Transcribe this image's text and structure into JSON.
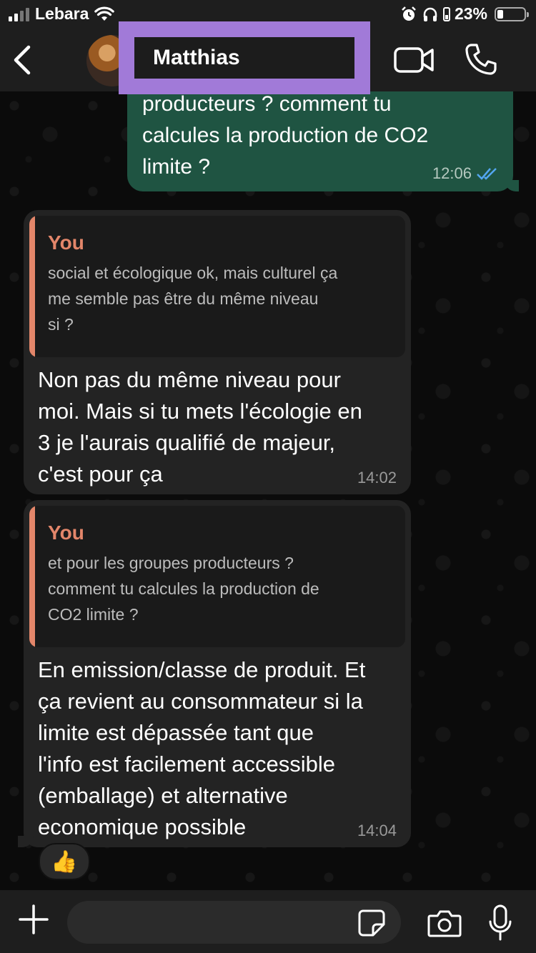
{
  "status_bar": {
    "carrier": "Lebara",
    "battery": "23%",
    "battery_level": 0.23
  },
  "header": {
    "contact_name": "Matthias"
  },
  "messages": {
    "outgoing": {
      "text": "producteurs ? comment tu\ncalcules la production de CO2\nlimite ?",
      "time": "12:06"
    },
    "incoming_1": {
      "quote_author": "You",
      "quote_text": "social et écologique ok, mais culturel ça\nme semble pas être du même niveau\nsi ?",
      "text": "Non pas du même niveau pour\nmoi. Mais si tu mets l'écologie en\n3 je l'aurais qualifié de majeur,\nc'est pour ça",
      "time": "14:02"
    },
    "incoming_2": {
      "quote_author": "You",
      "quote_text": "et pour les groupes producteurs ?\ncomment tu calcules la production de\nCO2 limite ?",
      "text": "En emission/classe de produit. Et\nça revient au consommateur si la\nlimite est dépassée tant que\nl'info est facilement accessible\n(emballage) et alternative\neconomique possible",
      "time": "14:04",
      "reaction": "👍"
    }
  },
  "input_bar": {
    "placeholder": ""
  },
  "colors": {
    "outgoing_bubble": "#1f5442",
    "incoming_bubble": "#232323",
    "quote_accent": "#e3866a",
    "read_ticks": "#53a6f0",
    "header_highlight": "#a17ad8"
  }
}
